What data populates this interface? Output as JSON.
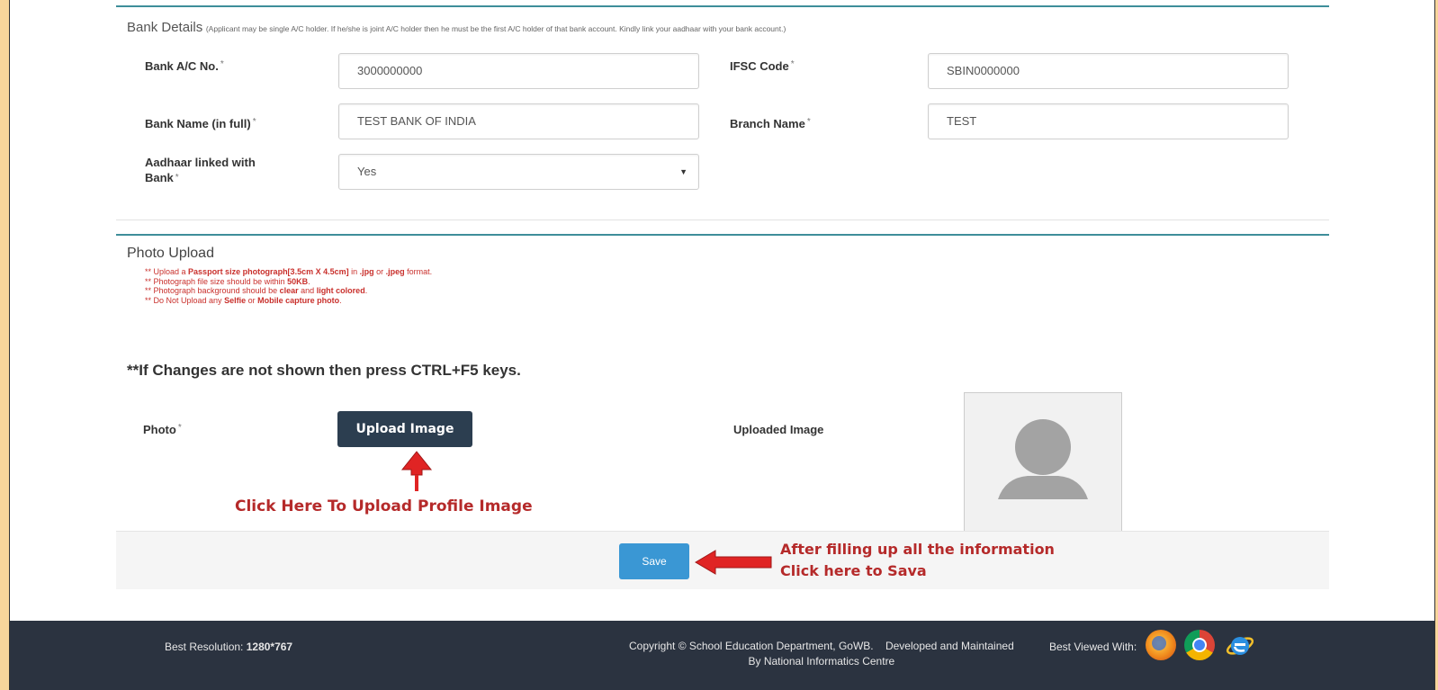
{
  "bank": {
    "title": "Bank Details",
    "note": "(Applicant may be single A/C holder. If he/she is joint A/C holder then he must be the first A/C holder of that bank account. Kindly link your aadhaar with your bank account.)",
    "required_mark": "*",
    "fields": {
      "account_no": {
        "label": "Bank A/C No.",
        "value": "3000000000"
      },
      "ifsc": {
        "label": "IFSC Code",
        "value": "SBIN0000000"
      },
      "bank_name": {
        "label": "Bank Name (in full)",
        "value": "TEST BANK OF INDIA"
      },
      "branch": {
        "label": "Branch Name",
        "value": "TEST"
      },
      "aadhaar_linked": {
        "label_line1": "Aadhaar linked with",
        "label_line2": "Bank",
        "value": "Yes"
      }
    }
  },
  "photo": {
    "title": "Photo Upload",
    "notes": {
      "n1_a": "** Upload a ",
      "n1_b": "Passport size photograph[3.5cm X 4.5cm]",
      "n1_c": " in ",
      "n1_d": ".jpg",
      "n1_e": " or ",
      "n1_f": ".jpeg",
      "n1_g": " format.",
      "n2_a": "** Photograph file size should be within ",
      "n2_b": "50KB",
      "n2_c": ".",
      "n3_a": "** Photograph background should be ",
      "n3_b": "clear",
      "n3_c": " and ",
      "n3_d": "light colored",
      "n3_e": ".",
      "n4_a": "** Do Not Upload any ",
      "n4_b": "Selfie",
      "n4_c": " or ",
      "n4_d": "Mobile capture photo",
      "n4_e": "."
    },
    "ctrl_note": "**If Changes are not shown then press CTRL+F5 keys.",
    "photo_label": "Photo",
    "upload_button": "Upload Image",
    "uploaded_label": "Uploaded Image",
    "annotation_upload": "Click Here To Upload Profile Image"
  },
  "save": {
    "button": "Save",
    "annotation_line1": "After filling up all the information",
    "annotation_line2": "Click here to Sava"
  },
  "footer": {
    "resolution_label": "Best Resolution: ",
    "resolution_value": "1280*767",
    "copyright_line1": "Copyright © School Education Department, GoWB.    Developed and Maintained",
    "copyright_line2": "By National Informatics Centre",
    "best_viewed": "Best Viewed With:",
    "browser_icons": [
      "firefox-icon",
      "chrome-icon",
      "internet-explorer-icon"
    ]
  },
  "colors": {
    "accent": "#3e8e9a",
    "upload_button": "#2c3e50",
    "save_button": "#3a97d4",
    "annotation": "#b52a2a",
    "arrow": "#e02424",
    "footer": "#2b3340",
    "outer_background": "#f7d59b"
  }
}
